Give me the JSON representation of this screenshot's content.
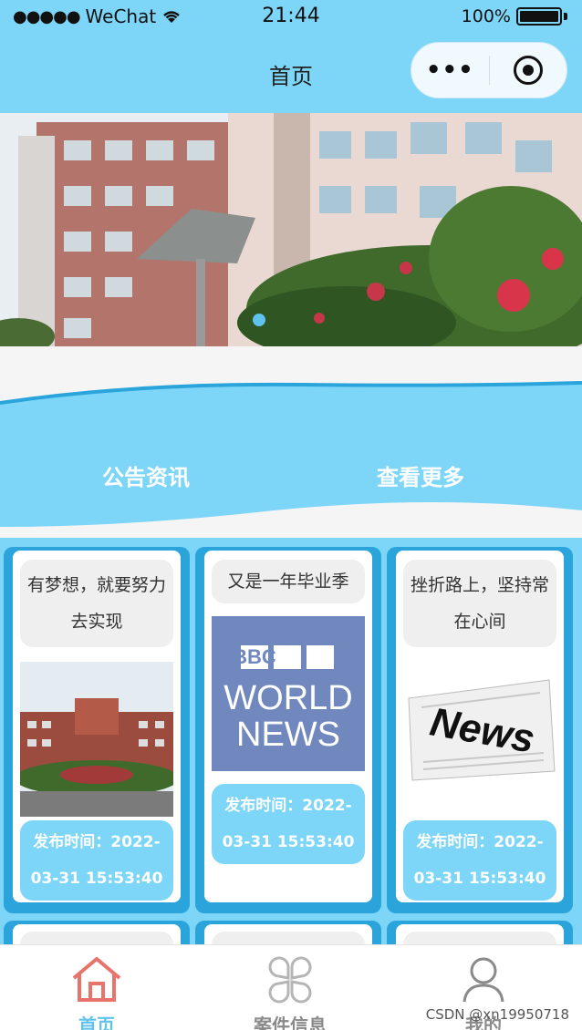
{
  "status_bar": {
    "carrier": "WeChat",
    "time": "21:44",
    "battery": "100%"
  },
  "nav": {
    "title": "首页",
    "more_symbol": "•••"
  },
  "banner": {
    "active_slide": 1
  },
  "notice": {
    "left_label": "公告资讯",
    "right_label": "查看更多"
  },
  "cards": [
    {
      "title": "有梦想，就要努力去实现",
      "date": "发布时间：2022-03-31 15:53:40",
      "image_icon": "campus-building-photo"
    },
    {
      "title": "又是一年毕业季",
      "date": "发布时间：2022-03-31 15:53:40",
      "image_icon": "bbc-world-news-logo",
      "image_text": [
        "BBC",
        "WORLD",
        "NEWS"
      ]
    },
    {
      "title": "挫折路上，坚持常在心间",
      "date": "发布时间：2022-03-31 15:53:40",
      "image_icon": "newspaper-image",
      "image_text": "News"
    }
  ],
  "tabs": [
    {
      "label": "首页",
      "icon": "home-icon",
      "active": true
    },
    {
      "label": "案件信息",
      "icon": "grid-icon",
      "active": false
    },
    {
      "label": "我的",
      "icon": "user-icon",
      "active": false
    }
  ],
  "colors": {
    "header": "#7dd6f7",
    "card_border": "#2aa4db",
    "active_tab": "#e8736a",
    "active_label": "#5fc3ee"
  },
  "watermark": "CSDN @xn19950718"
}
